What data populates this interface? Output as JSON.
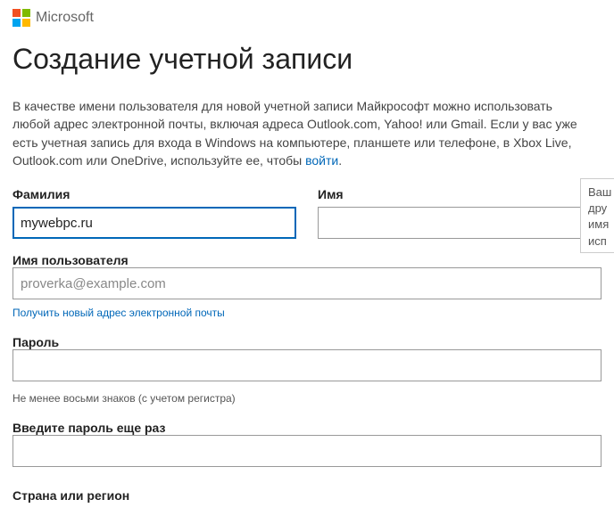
{
  "brand": "Microsoft",
  "title": "Создание учетной записи",
  "intro": {
    "text_before_link": "В качестве имени пользователя для новой учетной записи Майкрософт можно использовать любой адрес электронной почты, включая адреса Outlook.com, Yahoo! или Gmail. Если у вас уже есть учетная запись для входа в Windows на компьютере, планшете или телефоне, в Xbox Live, Outlook.com или OneDrive, используйте ее, чтобы ",
    "link_text": "войти",
    "text_after_link": "."
  },
  "surname": {
    "label": "Фамилия",
    "value": "mywebpc.ru"
  },
  "firstname": {
    "label": "Имя",
    "value": ""
  },
  "username": {
    "label": "Имя пользователя",
    "placeholder": "proverka@example.com",
    "value": "",
    "new_email_link": "Получить новый адрес электронной почты"
  },
  "password": {
    "label": "Пароль",
    "value": "",
    "hint": "Не менее восьми знаков (с учетом регистра)"
  },
  "password_confirm": {
    "label": "Введите пароль еще раз",
    "value": ""
  },
  "country": {
    "label": "Страна или регион"
  },
  "tooltip": {
    "l1": "Ваш",
    "l2": "дру",
    "l3": "имя",
    "l4": "исп"
  }
}
